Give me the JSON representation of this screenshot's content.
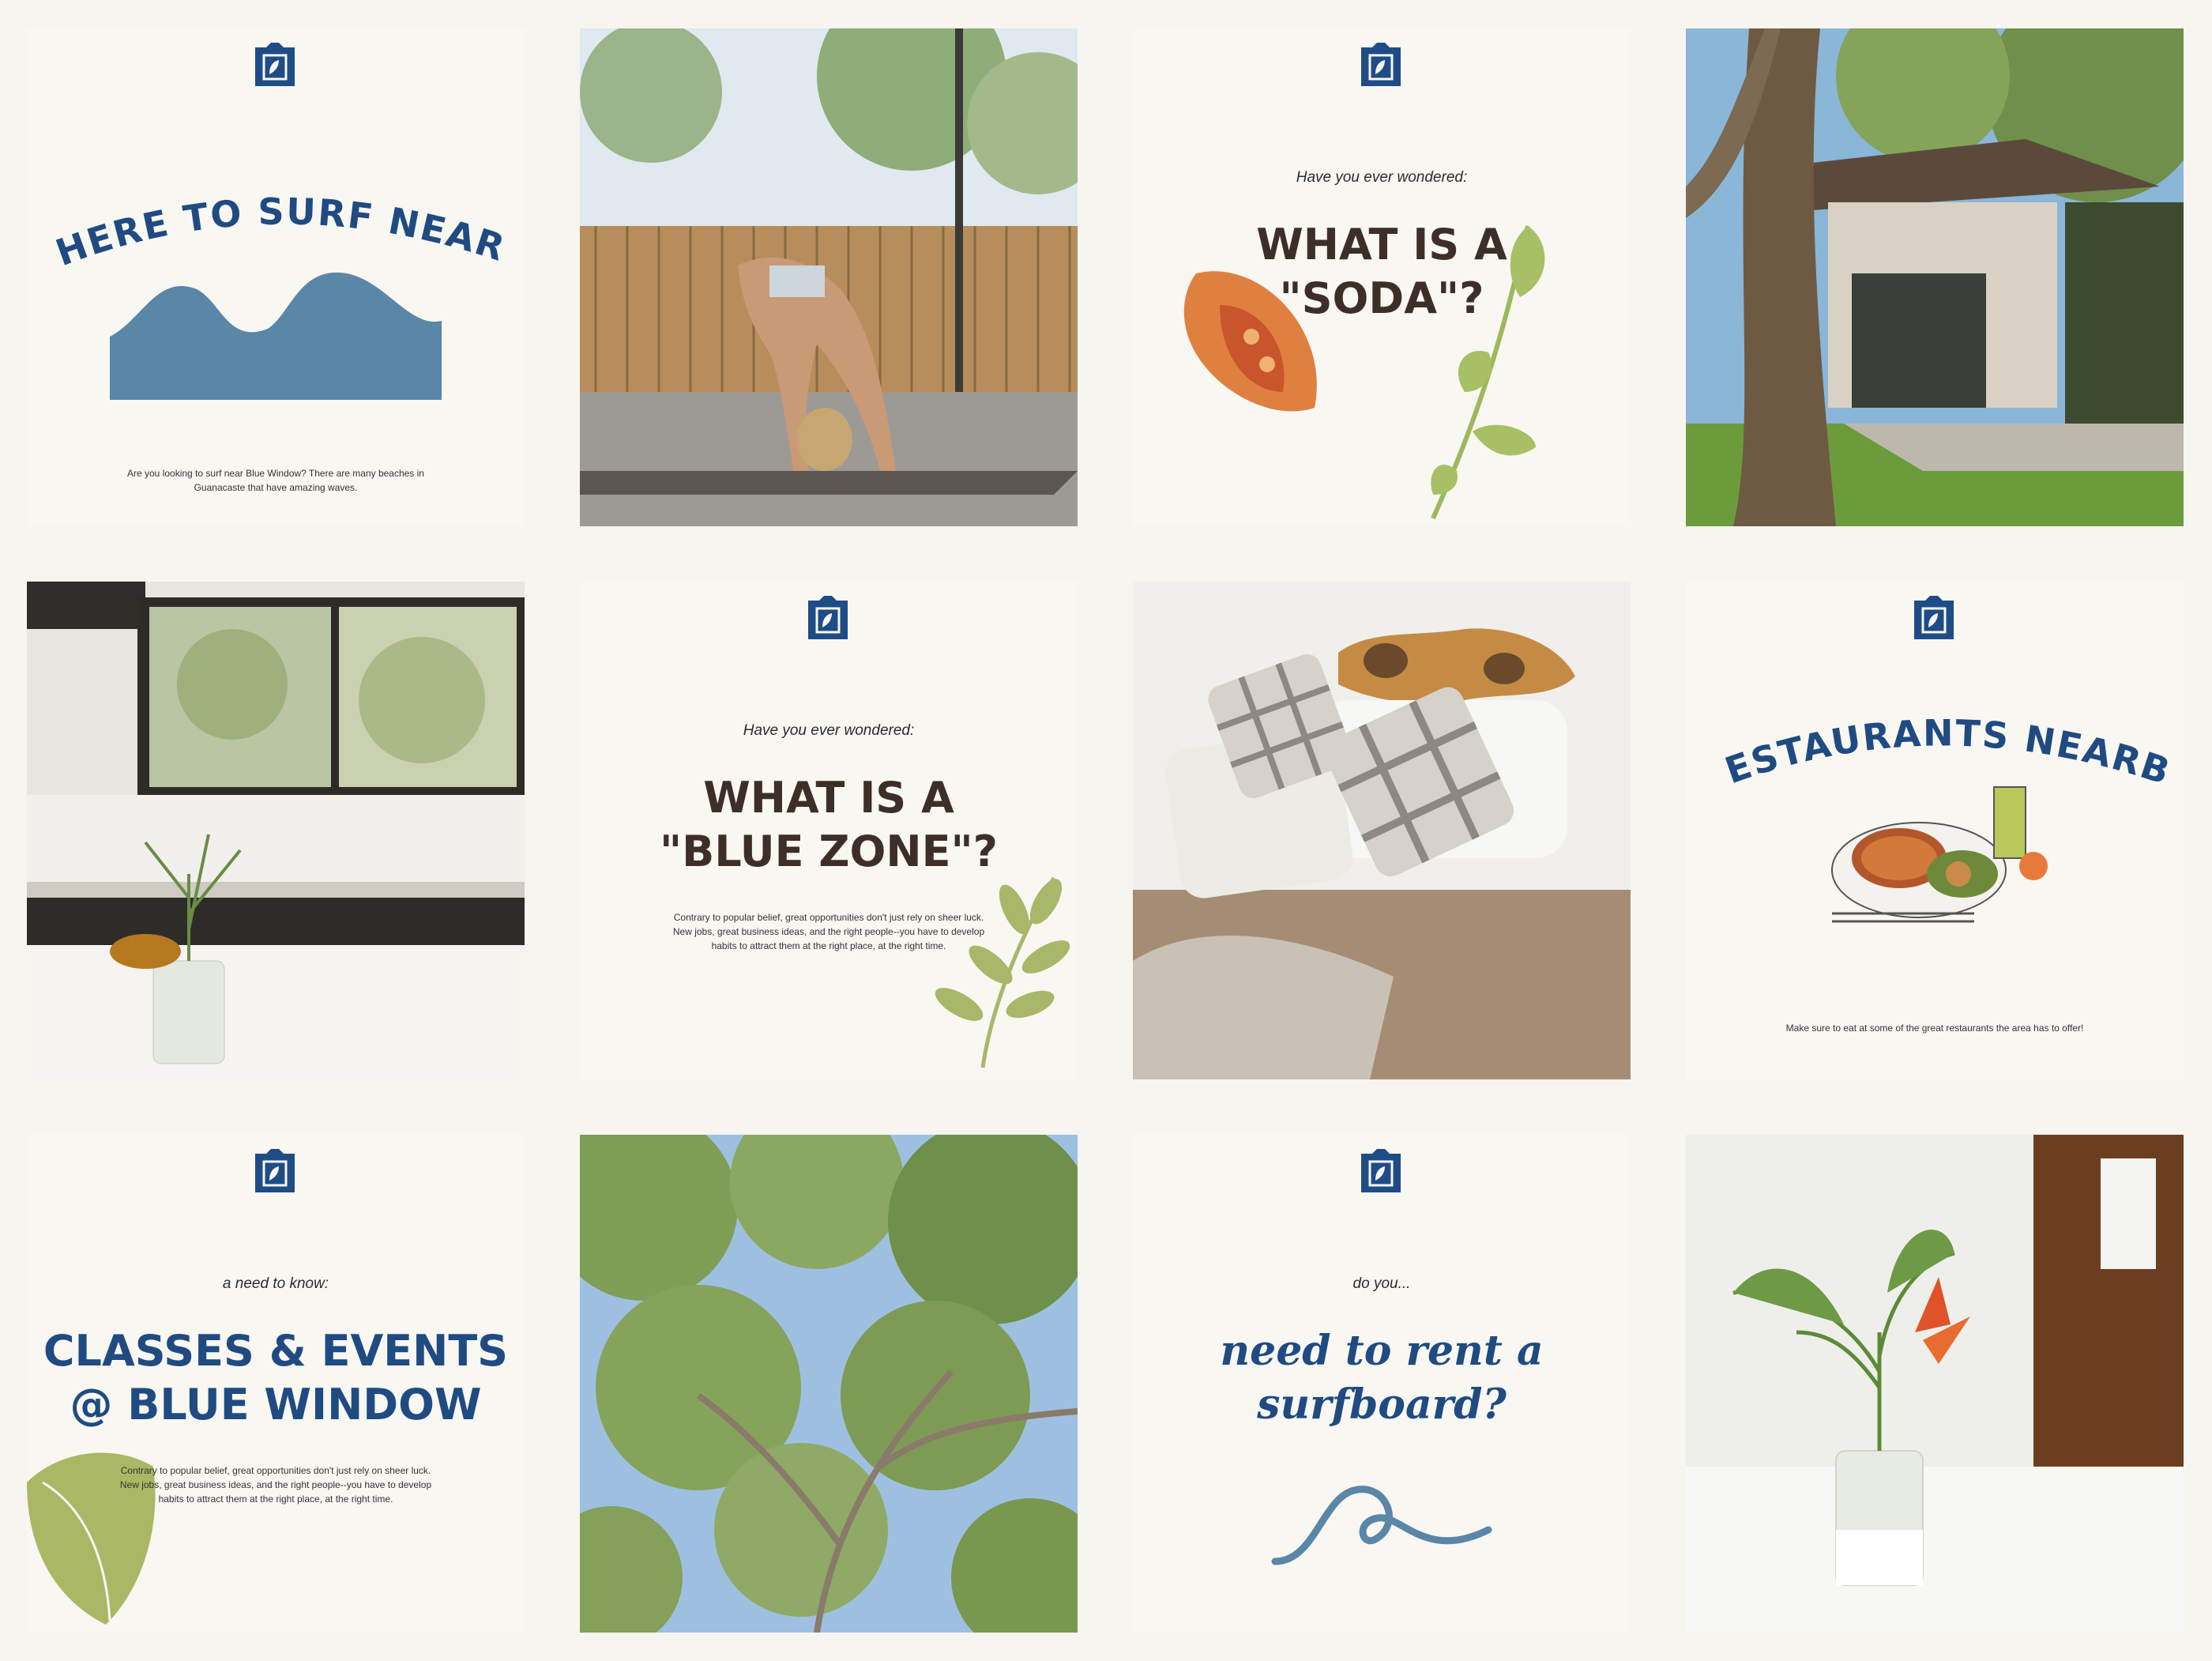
{
  "brand": {
    "name": "Blue Window",
    "logo_color": "#1e4c86",
    "accent_navy": "#1f4b82",
    "accent_green": "#a9b866",
    "accent_blue": "#5a86a8"
  },
  "tiles": {
    "surf": {
      "title": "WHERE TO SURF NEARBY",
      "body": "Are you looking to surf near Blue Window? There are many beaches in Guanacaste that have amazing waves."
    },
    "yoga": {
      "scene": "yoga-photo"
    },
    "soda": {
      "kicker": "Have you ever wondered:",
      "title_line1": "WHAT IS A",
      "title_line2": "\"SODA\"?"
    },
    "house": {
      "scene": "house-photo"
    },
    "kitchen": {
      "scene": "kitchen-photo"
    },
    "bluezone": {
      "kicker": "Have you ever wondered:",
      "title_line1": "WHAT IS A",
      "title_line2": "\"BLUE ZONE\"?",
      "body": "Contrary to popular belief, great opportunities don't just rely on sheer luck. New jobs, great business ideas, and the right people--you have to develop habits to attract them at the right place, at the right time."
    },
    "bedroom": {
      "scene": "bedroom-photo"
    },
    "restaurants": {
      "title": "RESTAURANTS NEARBY",
      "body": "Make sure to eat at some of the great restaurants the area has to offer!"
    },
    "classes": {
      "kicker": "a need to know:",
      "title_line1": "CLASSES & EVENTS",
      "title_line2": "@ BLUE WINDOW",
      "body": "Contrary to popular belief, great opportunities don't just rely on sheer luck. New jobs, great business ideas, and the right people--you have to develop habits to attract them at the right place, at the right time."
    },
    "trees": {
      "scene": "tree-canopy-photo"
    },
    "surfboard": {
      "kicker": "do you...",
      "title_line1": "need to rent a",
      "title_line2": "surfboard?"
    },
    "plant": {
      "scene": "plant-photo"
    }
  }
}
